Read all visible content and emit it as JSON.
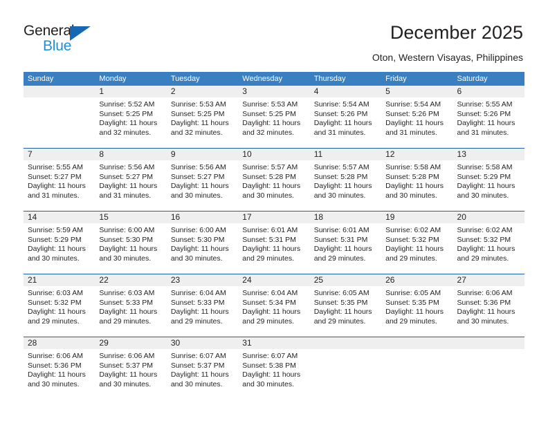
{
  "brand": {
    "name_top": "General",
    "name_bottom": "Blue",
    "color_dark": "#231f20",
    "color_blue": "#1f8fd8",
    "triangle_color": "#1668b3"
  },
  "header": {
    "title": "December 2025",
    "subtitle": "Oton, Western Visayas, Philippines"
  },
  "calendar": {
    "header_bg": "#3a7fc1",
    "row_divider": "#1b5fa5",
    "day_band_bg": "#efefef",
    "weekdays": [
      "Sunday",
      "Monday",
      "Tuesday",
      "Wednesday",
      "Thursday",
      "Friday",
      "Saturday"
    ],
    "weeks": [
      [
        {
          "day": "",
          "sunrise": "",
          "sunset": "",
          "daylight": "",
          "daylight2": "",
          "empty": true
        },
        {
          "day": "1",
          "sunrise": "Sunrise: 5:52 AM",
          "sunset": "Sunset: 5:25 PM",
          "daylight": "Daylight: 11 hours",
          "daylight2": "and 32 minutes."
        },
        {
          "day": "2",
          "sunrise": "Sunrise: 5:53 AM",
          "sunset": "Sunset: 5:25 PM",
          "daylight": "Daylight: 11 hours",
          "daylight2": "and 32 minutes."
        },
        {
          "day": "3",
          "sunrise": "Sunrise: 5:53 AM",
          "sunset": "Sunset: 5:25 PM",
          "daylight": "Daylight: 11 hours",
          "daylight2": "and 32 minutes."
        },
        {
          "day": "4",
          "sunrise": "Sunrise: 5:54 AM",
          "sunset": "Sunset: 5:26 PM",
          "daylight": "Daylight: 11 hours",
          "daylight2": "and 31 minutes."
        },
        {
          "day": "5",
          "sunrise": "Sunrise: 5:54 AM",
          "sunset": "Sunset: 5:26 PM",
          "daylight": "Daylight: 11 hours",
          "daylight2": "and 31 minutes."
        },
        {
          "day": "6",
          "sunrise": "Sunrise: 5:55 AM",
          "sunset": "Sunset: 5:26 PM",
          "daylight": "Daylight: 11 hours",
          "daylight2": "and 31 minutes."
        }
      ],
      [
        {
          "day": "7",
          "sunrise": "Sunrise: 5:55 AM",
          "sunset": "Sunset: 5:27 PM",
          "daylight": "Daylight: 11 hours",
          "daylight2": "and 31 minutes."
        },
        {
          "day": "8",
          "sunrise": "Sunrise: 5:56 AM",
          "sunset": "Sunset: 5:27 PM",
          "daylight": "Daylight: 11 hours",
          "daylight2": "and 31 minutes."
        },
        {
          "day": "9",
          "sunrise": "Sunrise: 5:56 AM",
          "sunset": "Sunset: 5:27 PM",
          "daylight": "Daylight: 11 hours",
          "daylight2": "and 30 minutes."
        },
        {
          "day": "10",
          "sunrise": "Sunrise: 5:57 AM",
          "sunset": "Sunset: 5:28 PM",
          "daylight": "Daylight: 11 hours",
          "daylight2": "and 30 minutes."
        },
        {
          "day": "11",
          "sunrise": "Sunrise: 5:57 AM",
          "sunset": "Sunset: 5:28 PM",
          "daylight": "Daylight: 11 hours",
          "daylight2": "and 30 minutes."
        },
        {
          "day": "12",
          "sunrise": "Sunrise: 5:58 AM",
          "sunset": "Sunset: 5:28 PM",
          "daylight": "Daylight: 11 hours",
          "daylight2": "and 30 minutes."
        },
        {
          "day": "13",
          "sunrise": "Sunrise: 5:58 AM",
          "sunset": "Sunset: 5:29 PM",
          "daylight": "Daylight: 11 hours",
          "daylight2": "and 30 minutes."
        }
      ],
      [
        {
          "day": "14",
          "sunrise": "Sunrise: 5:59 AM",
          "sunset": "Sunset: 5:29 PM",
          "daylight": "Daylight: 11 hours",
          "daylight2": "and 30 minutes."
        },
        {
          "day": "15",
          "sunrise": "Sunrise: 6:00 AM",
          "sunset": "Sunset: 5:30 PM",
          "daylight": "Daylight: 11 hours",
          "daylight2": "and 30 minutes."
        },
        {
          "day": "16",
          "sunrise": "Sunrise: 6:00 AM",
          "sunset": "Sunset: 5:30 PM",
          "daylight": "Daylight: 11 hours",
          "daylight2": "and 30 minutes."
        },
        {
          "day": "17",
          "sunrise": "Sunrise: 6:01 AM",
          "sunset": "Sunset: 5:31 PM",
          "daylight": "Daylight: 11 hours",
          "daylight2": "and 29 minutes."
        },
        {
          "day": "18",
          "sunrise": "Sunrise: 6:01 AM",
          "sunset": "Sunset: 5:31 PM",
          "daylight": "Daylight: 11 hours",
          "daylight2": "and 29 minutes."
        },
        {
          "day": "19",
          "sunrise": "Sunrise: 6:02 AM",
          "sunset": "Sunset: 5:32 PM",
          "daylight": "Daylight: 11 hours",
          "daylight2": "and 29 minutes."
        },
        {
          "day": "20",
          "sunrise": "Sunrise: 6:02 AM",
          "sunset": "Sunset: 5:32 PM",
          "daylight": "Daylight: 11 hours",
          "daylight2": "and 29 minutes."
        }
      ],
      [
        {
          "day": "21",
          "sunrise": "Sunrise: 6:03 AM",
          "sunset": "Sunset: 5:32 PM",
          "daylight": "Daylight: 11 hours",
          "daylight2": "and 29 minutes."
        },
        {
          "day": "22",
          "sunrise": "Sunrise: 6:03 AM",
          "sunset": "Sunset: 5:33 PM",
          "daylight": "Daylight: 11 hours",
          "daylight2": "and 29 minutes."
        },
        {
          "day": "23",
          "sunrise": "Sunrise: 6:04 AM",
          "sunset": "Sunset: 5:33 PM",
          "daylight": "Daylight: 11 hours",
          "daylight2": "and 29 minutes."
        },
        {
          "day": "24",
          "sunrise": "Sunrise: 6:04 AM",
          "sunset": "Sunset: 5:34 PM",
          "daylight": "Daylight: 11 hours",
          "daylight2": "and 29 minutes."
        },
        {
          "day": "25",
          "sunrise": "Sunrise: 6:05 AM",
          "sunset": "Sunset: 5:35 PM",
          "daylight": "Daylight: 11 hours",
          "daylight2": "and 29 minutes."
        },
        {
          "day": "26",
          "sunrise": "Sunrise: 6:05 AM",
          "sunset": "Sunset: 5:35 PM",
          "daylight": "Daylight: 11 hours",
          "daylight2": "and 29 minutes."
        },
        {
          "day": "27",
          "sunrise": "Sunrise: 6:06 AM",
          "sunset": "Sunset: 5:36 PM",
          "daylight": "Daylight: 11 hours",
          "daylight2": "and 30 minutes."
        }
      ],
      [
        {
          "day": "28",
          "sunrise": "Sunrise: 6:06 AM",
          "sunset": "Sunset: 5:36 PM",
          "daylight": "Daylight: 11 hours",
          "daylight2": "and 30 minutes."
        },
        {
          "day": "29",
          "sunrise": "Sunrise: 6:06 AM",
          "sunset": "Sunset: 5:37 PM",
          "daylight": "Daylight: 11 hours",
          "daylight2": "and 30 minutes."
        },
        {
          "day": "30",
          "sunrise": "Sunrise: 6:07 AM",
          "sunset": "Sunset: 5:37 PM",
          "daylight": "Daylight: 11 hours",
          "daylight2": "and 30 minutes."
        },
        {
          "day": "31",
          "sunrise": "Sunrise: 6:07 AM",
          "sunset": "Sunset: 5:38 PM",
          "daylight": "Daylight: 11 hours",
          "daylight2": "and 30 minutes."
        },
        {
          "day": "",
          "sunrise": "",
          "sunset": "",
          "daylight": "",
          "daylight2": "",
          "empty": true
        },
        {
          "day": "",
          "sunrise": "",
          "sunset": "",
          "daylight": "",
          "daylight2": "",
          "empty": true
        },
        {
          "day": "",
          "sunrise": "",
          "sunset": "",
          "daylight": "",
          "daylight2": "",
          "empty": true
        }
      ]
    ]
  }
}
